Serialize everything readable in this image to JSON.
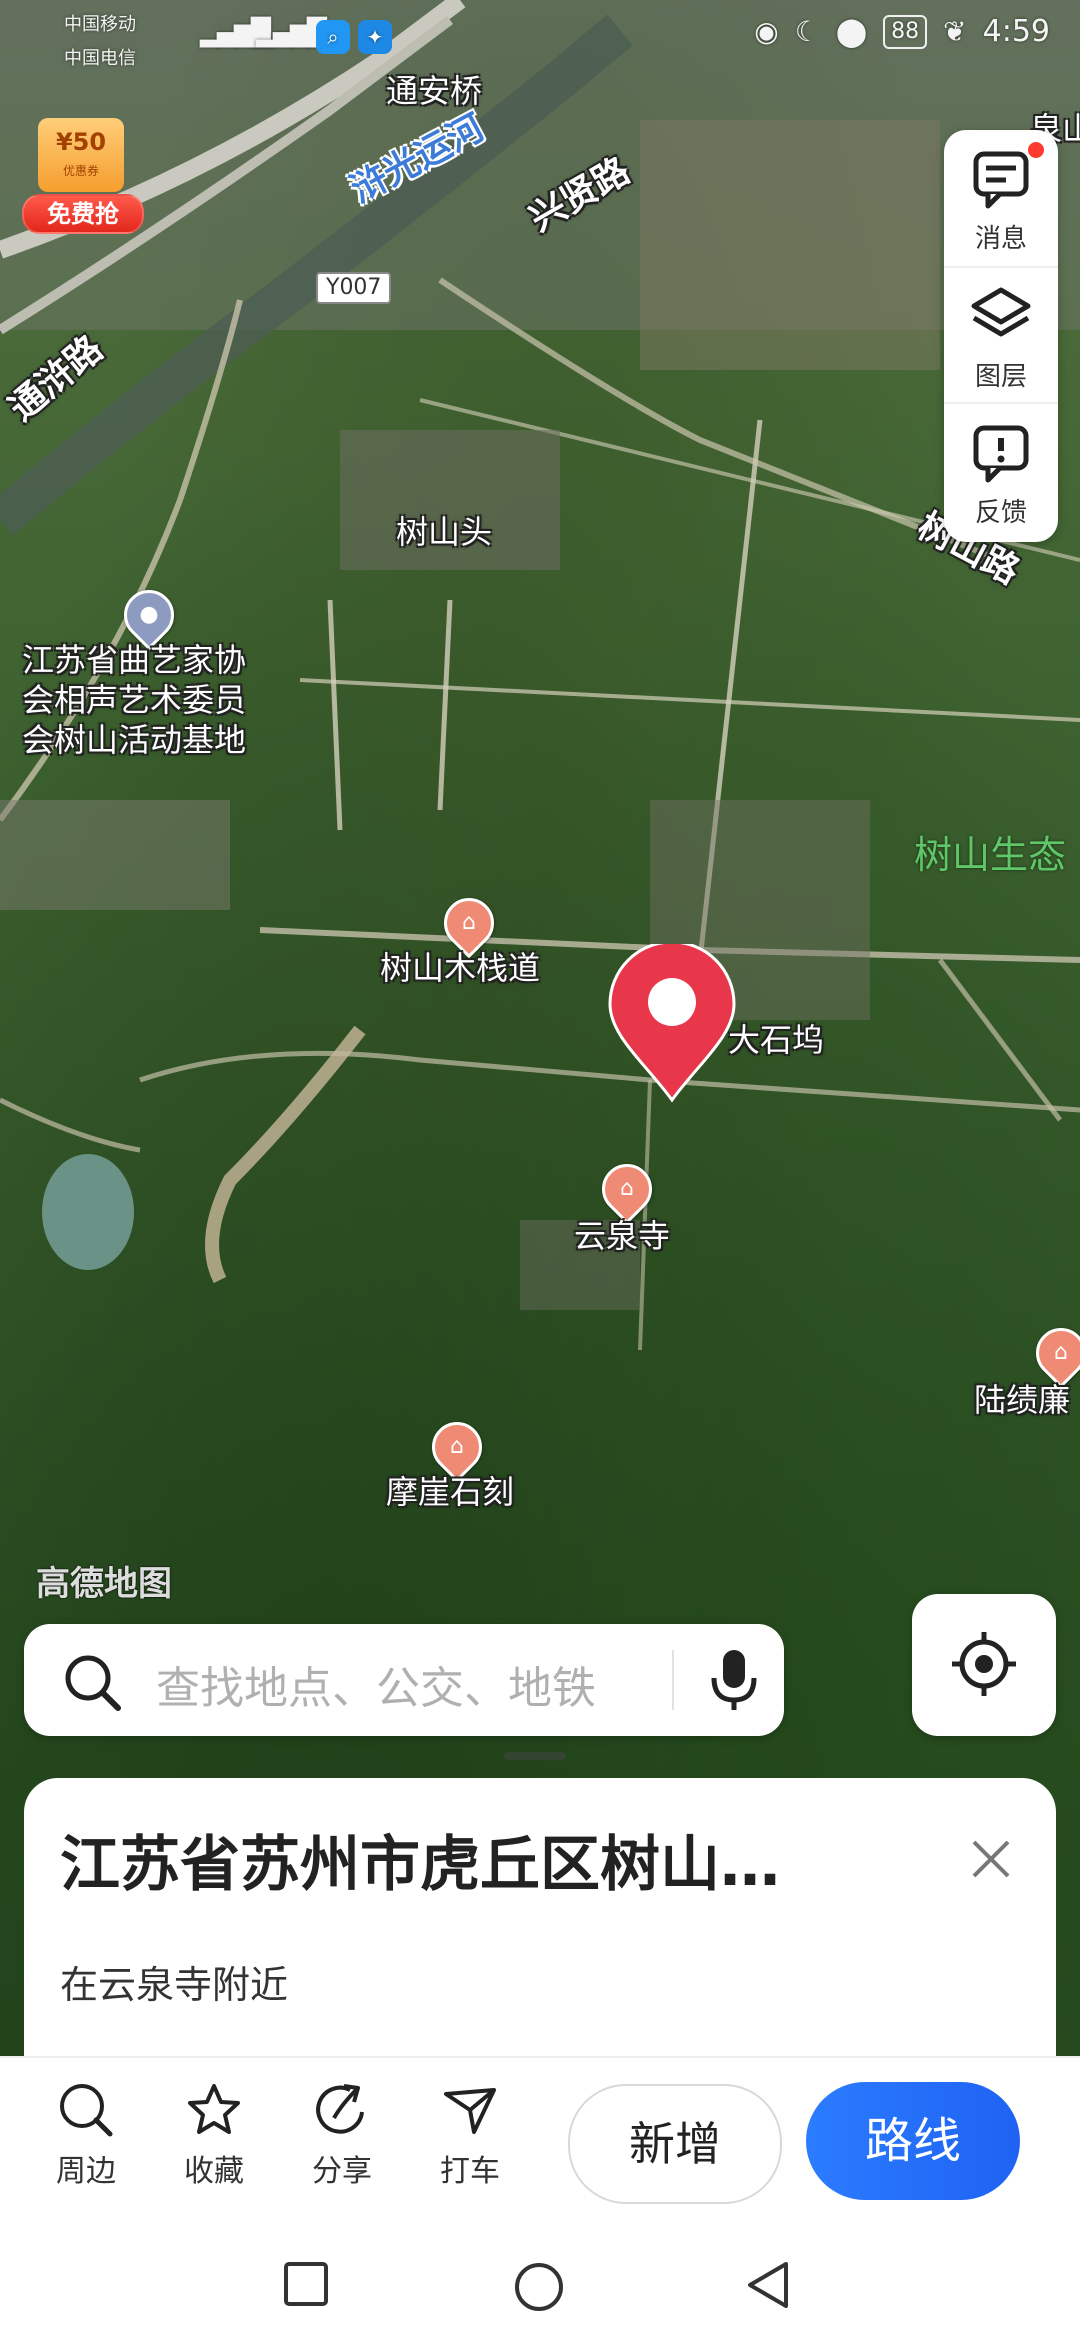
{
  "status_bar": {
    "carrier1": "中国移动",
    "carrier2": "中国电信",
    "battery": "88",
    "time": "4:59"
  },
  "promo": {
    "coupon_amount": "¥50",
    "coupon_text": "优惠券",
    "label": "免费抢"
  },
  "map": {
    "watermark": "高德地图",
    "road_tag": "Y007",
    "roads": {
      "tongan_bridge": "通安桥",
      "canal": "浒光运河",
      "xingxian_road": "兴贤路",
      "tongxu_road": "通浒路",
      "shushan_road": "树山路",
      "eco_park": "树山生态",
      "quan_partial": "泉山"
    },
    "pois": {
      "shushantou": "树山头",
      "quyi_base": "江苏省曲艺家协\n会相声艺术委员\n会树山活动基地",
      "boardwalk": "树山木栈道",
      "dashiwu": "大石坞",
      "yunquan_temple": "云泉寺",
      "cliff_carving": "摩崖石刻",
      "lujilian": "陆绩廉"
    }
  },
  "side_panel": {
    "messages": "消息",
    "layers": "图层",
    "feedback": "反馈"
  },
  "search": {
    "placeholder": "查找地点、公交、地铁"
  },
  "card": {
    "title": "江苏省苏州市虎丘区树山…",
    "subtitle": "在云泉寺附近"
  },
  "actions": {
    "nearby": "周边",
    "favorite": "收藏",
    "share": "分享",
    "taxi": "打车",
    "add_new": "新增",
    "route": "路线"
  },
  "colors": {
    "primary": "#1f62f3",
    "pin_red": "#e8364a",
    "poi_orange": "#ef8a74"
  }
}
